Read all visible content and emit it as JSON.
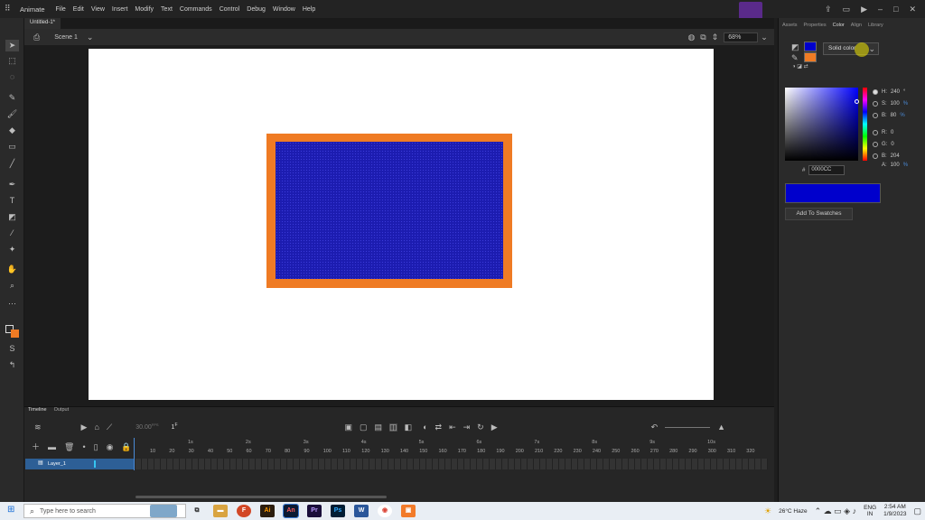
{
  "app": {
    "name": "Animate"
  },
  "menu": [
    "File",
    "Edit",
    "View",
    "Insert",
    "Modify",
    "Text",
    "Commands",
    "Control",
    "Debug",
    "Window",
    "Help"
  ],
  "document": {
    "tab_title": "Untitled-1*",
    "scene": "Scene 1",
    "zoom": "68%"
  },
  "colors": {
    "stage_fill": "#1c1cb0",
    "stage_stroke": "#ef7b24",
    "accent": "#2d5f96"
  },
  "timeline": {
    "tabs": [
      "Timeline",
      "Output"
    ],
    "fps": "30.00",
    "fps_unit": "FPS",
    "frame": "1",
    "frame_unit": "F",
    "ruler_seconds": [
      "1s",
      "2s",
      "3s",
      "4s",
      "5s",
      "6s",
      "7s",
      "8s",
      "9s",
      "10s"
    ],
    "ruler_frames": [
      "10",
      "20",
      "30",
      "40",
      "50",
      "60",
      "70",
      "80",
      "90",
      "100",
      "110",
      "120",
      "130",
      "140",
      "150",
      "160",
      "170",
      "180",
      "190",
      "200",
      "210",
      "220",
      "230",
      "240",
      "250",
      "260",
      "270",
      "280",
      "290",
      "300",
      "310",
      "320"
    ],
    "layer_name": "Layer_1"
  },
  "panel": {
    "tabs": [
      "Assets",
      "Properties",
      "Color",
      "Align",
      "Library"
    ],
    "active_tab": "Color",
    "fill_type": "Solid color",
    "hsb": {
      "h_label": "H:",
      "h": "240",
      "h_unit": "°",
      "s_label": "S:",
      "s": "100",
      "s_unit": "%",
      "b_label": "B:",
      "b": "80",
      "b_unit": "%"
    },
    "rgb": {
      "r_label": "R:",
      "r": "0",
      "g_label": "G:",
      "g": "0",
      "b_label": "B:",
      "b": "204",
      "a_label": "A:",
      "a": "100",
      "a_unit": "%"
    },
    "hex_label": "#",
    "hex": "0000CC",
    "add_swatch_label": "Add To Swatches"
  },
  "taskbar": {
    "search_placeholder": "Type here to search",
    "weather": "26°C Haze",
    "lang": "ENG",
    "region": "IN",
    "time": "2:54 AM",
    "date": "1/9/2023"
  },
  "icons": [
    "search-icon",
    "play-icon",
    "gear-icon",
    "brush-icon",
    "pen-icon",
    "rectangle-icon",
    "hand-icon",
    "zoom-icon"
  ]
}
